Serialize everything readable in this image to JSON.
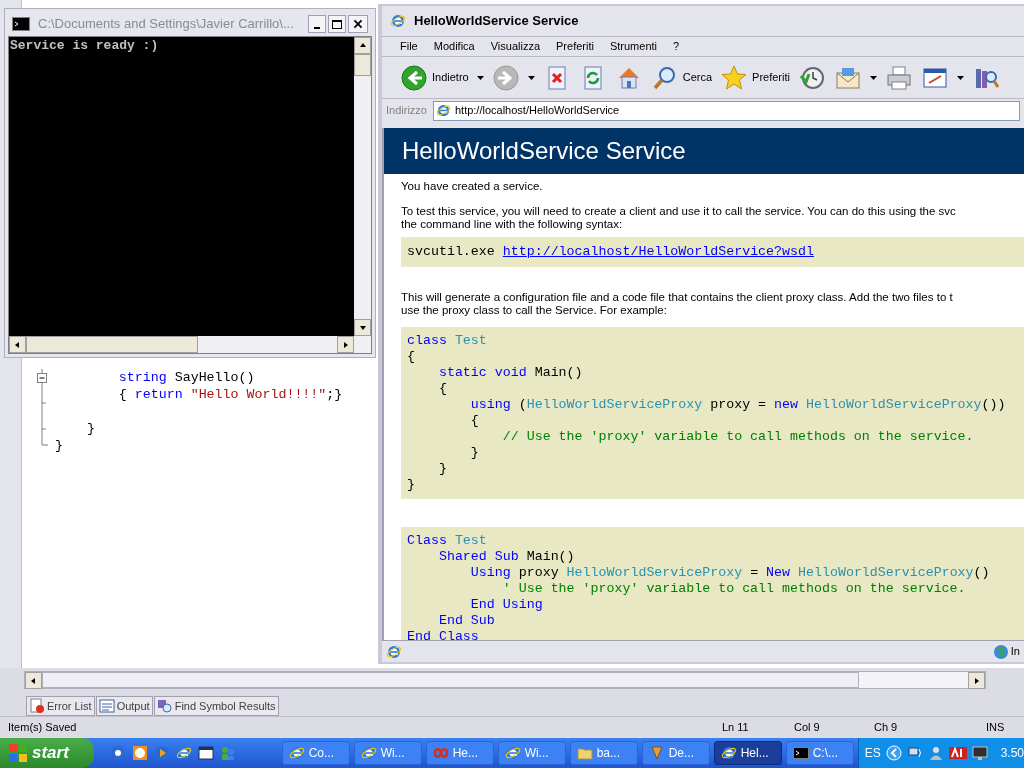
{
  "console_window": {
    "title": "C:\\Documents and Settings\\Javier Carrillo\\...",
    "output": "Service is ready :)"
  },
  "editor": {
    "lines": [
      {
        "kind": "code",
        "segments": [
          {
            "kind": "keyword",
            "text": "        string"
          },
          {
            "kind": "plain",
            "text": " SayHello()"
          }
        ]
      },
      {
        "kind": "code",
        "segments": [
          {
            "kind": "plain",
            "text": "        { "
          },
          {
            "kind": "keyword",
            "text": "return "
          },
          {
            "kind": "string",
            "text": "\"Hello World!!!!\""
          },
          {
            "kind": "plain",
            "text": ";}"
          }
        ]
      },
      {
        "kind": "blank"
      },
      {
        "kind": "code",
        "segments": [
          {
            "kind": "plain",
            "text": "    }"
          }
        ]
      },
      {
        "kind": "code",
        "segments": [
          {
            "kind": "plain",
            "text": "}"
          }
        ]
      }
    ]
  },
  "browser": {
    "title": "HelloWorldService Service",
    "menu": [
      "File",
      "Modifica",
      "Visualizza",
      "Preferiti",
      "Strumenti",
      "?"
    ],
    "toolbar": [
      {
        "kind": "back",
        "label": "Indietro",
        "disabled": false,
        "has_menu": true
      },
      {
        "kind": "forward",
        "disabled": true,
        "has_menu": true
      },
      {
        "kind": "stop",
        "disabled": false,
        "has_menu": false
      },
      {
        "kind": "refresh",
        "disabled": false,
        "has_menu": false
      },
      {
        "kind": "home",
        "disabled": false,
        "has_menu": false
      },
      {
        "kind": "search",
        "label": "Cerca",
        "disabled": false,
        "has_menu": false
      },
      {
        "kind": "favorites",
        "label": "Preferiti",
        "disabled": false,
        "has_menu": false
      },
      {
        "kind": "history",
        "disabled": false,
        "has_menu": false
      },
      {
        "kind": "mail",
        "disabled": false,
        "has_menu": true
      },
      {
        "kind": "print",
        "disabled": false,
        "has_menu": false
      },
      {
        "kind": "edit",
        "disabled": false,
        "has_menu": true
      },
      {
        "kind": "research",
        "disabled": false,
        "has_menu": false
      }
    ],
    "address_label": "Indirizzo",
    "address": "http://localhost/HelloWorldService",
    "page": {
      "heading": "HelloWorldService Service",
      "blocks": [
        {
          "kind": "text",
          "lines": [
            "You have created a service."
          ]
        },
        {
          "kind": "text",
          "lines": [
            "To test this service, you will need to create a client and use it to call the service. You can do this using the svc",
            "the command line with the following syntax:"
          ]
        },
        {
          "kind": "command",
          "text": "svcutil.exe",
          "link": "http://localhost/HelloWorldService?wsdl"
        },
        {
          "kind": "text",
          "lines": [
            "This will generate a configuration file and a code file that contains the client proxy class. Add the two files to t",
            "use the proxy class to call the Service. For example:"
          ]
        },
        {
          "kind": "code",
          "lines": [
            [
              {
                "kind": "keyword",
                "text": "class "
              },
              {
                "kind": "type",
                "text": "Test"
              }
            ],
            [
              {
                "kind": "plain",
                "text": "{"
              }
            ],
            [
              {
                "kind": "keyword",
                "text": "    static void"
              },
              {
                "kind": "plain",
                "text": " Main()"
              }
            ],
            [
              {
                "kind": "plain",
                "text": "    {"
              }
            ],
            [
              {
                "kind": "keyword",
                "text": "        using"
              },
              {
                "kind": "plain",
                "text": " ("
              },
              {
                "kind": "type",
                "text": "HelloWorldServiceProxy"
              },
              {
                "kind": "plain",
                "text": " proxy = "
              },
              {
                "kind": "keyword",
                "text": "new "
              },
              {
                "kind": "type",
                "text": "HelloWorldServiceProxy"
              },
              {
                "kind": "plain",
                "text": "())"
              }
            ],
            [
              {
                "kind": "plain",
                "text": "        {"
              }
            ],
            [
              {
                "kind": "comment",
                "text": "            // Use the 'proxy' variable to call methods on the service."
              }
            ],
            [
              {
                "kind": "plain",
                "text": "        }"
              }
            ],
            [
              {
                "kind": "plain",
                "text": "    }"
              }
            ],
            [
              {
                "kind": "plain",
                "text": "}"
              }
            ]
          ]
        },
        {
          "kind": "code",
          "lines": [
            [
              {
                "kind": "keyword",
                "text": "Class "
              },
              {
                "kind": "type",
                "text": "Test"
              }
            ],
            [
              {
                "kind": "keyword",
                "text": "    Shared Sub"
              },
              {
                "kind": "plain",
                "text": " Main()"
              }
            ],
            [
              {
                "kind": "keyword",
                "text": "        Using"
              },
              {
                "kind": "plain",
                "text": " proxy "
              },
              {
                "kind": "type",
                "text": "HelloWorldServiceProxy"
              },
              {
                "kind": "plain",
                "text": " = "
              },
              {
                "kind": "keyword",
                "text": "New "
              },
              {
                "kind": "type",
                "text": "HelloWorldServiceProxy"
              },
              {
                "kind": "plain",
                "text": "()"
              }
            ],
            [
              {
                "kind": "comment",
                "text": "            ' Use the 'proxy' variable to call methods on the service."
              }
            ],
            [
              {
                "kind": "keyword",
                "text": "        End Using"
              }
            ],
            [
              {
                "kind": "keyword",
                "text": "    End Sub"
              }
            ],
            [
              {
                "kind": "keyword",
                "text": "End Class"
              }
            ]
          ]
        }
      ]
    },
    "status": "In"
  },
  "bottom_tabs": [
    {
      "kind": "errors",
      "label": "Error List"
    },
    {
      "kind": "output",
      "label": "Output"
    },
    {
      "kind": "symbols",
      "label": "Find Symbol Results"
    }
  ],
  "status_bar": {
    "message": "Item(s) Saved",
    "line": "Ln 11",
    "column": "Col 9",
    "char": "Ch 9",
    "mode": "INS"
  },
  "taskbar": {
    "start": "start",
    "tasks": [
      {
        "kind": "browser",
        "label": "Co...",
        "selected": false
      },
      {
        "kind": "browser",
        "label": "Wi...",
        "selected": false
      },
      {
        "kind": "studio",
        "label": "He...",
        "selected": false
      },
      {
        "kind": "browser",
        "label": "Wi...",
        "selected": false
      },
      {
        "kind": "folder",
        "label": "ba...",
        "selected": false
      },
      {
        "kind": "tool",
        "label": "De...",
        "selected": false
      },
      {
        "kind": "browser",
        "label": "Hel...",
        "selected": true
      },
      {
        "kind": "console",
        "label": "C:\\...",
        "selected": false
      }
    ],
    "language": "ES",
    "clock": "3.50"
  }
}
